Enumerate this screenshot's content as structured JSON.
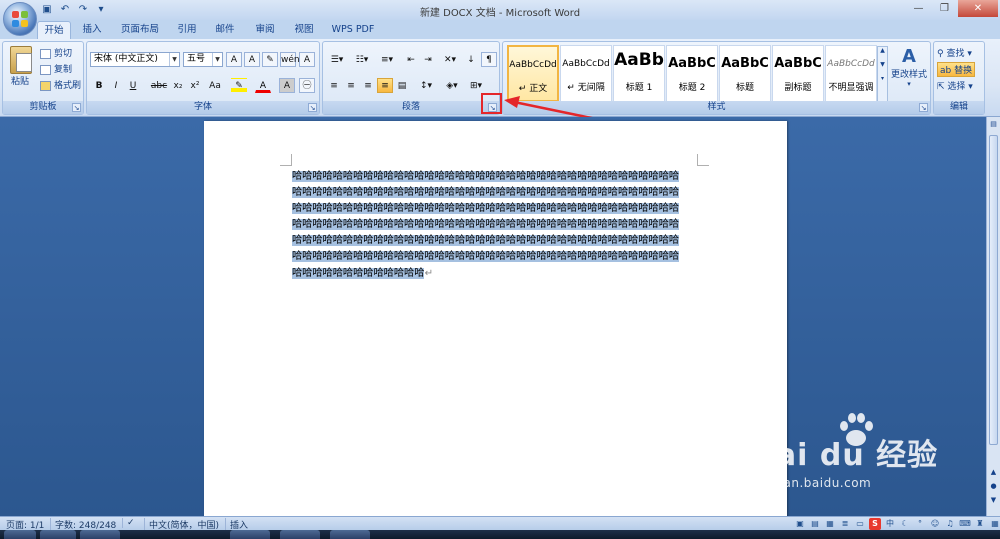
{
  "window": {
    "title": "新建 DOCX 文档 - Microsoft Word",
    "controls": [
      "—",
      "❐",
      "✕"
    ]
  },
  "quick_access": {
    "save_icon": "save-icon",
    "undo_icon": "undo-icon",
    "redo_icon": "redo-icon"
  },
  "tabs": [
    "开始",
    "插入",
    "页面布局",
    "引用",
    "邮件",
    "审阅",
    "视图",
    "WPS PDF"
  ],
  "active_tab": "开始",
  "ribbon": {
    "clipboard": {
      "label": "剪贴板",
      "paste": "粘贴",
      "cut": "剪切",
      "copy": "复制",
      "format_painter": "格式刷"
    },
    "font": {
      "label": "字体",
      "font_name": "宋体 (中文正文)",
      "font_size": "五号",
      "buttons": [
        "B",
        "I",
        "U",
        "abc",
        "x₂",
        "x²",
        "Aa",
        "A",
        "A"
      ]
    },
    "paragraph": {
      "label": "段落"
    },
    "styles": {
      "label": "样式",
      "items": [
        {
          "preview": "AaBbCcDd",
          "name": "↵ 正文"
        },
        {
          "preview": "AaBbCcDd",
          "name": "↵ 无间隔"
        },
        {
          "preview": "AaBb",
          "name": "标题 1"
        },
        {
          "preview": "AaBbC",
          "name": "标题 2"
        },
        {
          "preview": "AaBbC",
          "name": "标题"
        },
        {
          "preview": "AaBbC",
          "name": "副标题"
        },
        {
          "preview": "AaBbCcDd",
          "name": "不明显强调"
        }
      ],
      "change_styles": "更改样式"
    },
    "editing": {
      "label": "编辑",
      "find": "查找 ▾",
      "replace": "替换",
      "select": "选择 ▾"
    }
  },
  "document": {
    "lines": [
      "哈哈哈哈哈哈哈哈哈哈哈哈哈哈哈哈哈哈哈哈哈哈哈哈哈哈哈哈哈哈哈哈哈哈哈哈哈哈",
      "哈哈哈哈哈哈哈哈哈哈哈哈哈哈哈哈哈哈哈哈哈哈哈哈哈哈哈哈哈哈哈哈哈哈哈哈哈哈",
      "哈哈哈哈哈哈哈哈哈哈哈哈哈哈哈哈哈哈哈哈哈哈哈哈哈哈哈哈哈哈哈哈哈哈哈哈哈哈",
      "哈哈哈哈哈哈哈哈哈哈哈哈哈哈哈哈哈哈哈哈哈哈哈哈哈哈哈哈哈哈哈哈哈哈哈哈哈哈",
      "哈哈哈哈哈哈哈哈哈哈哈哈哈哈哈哈哈哈哈哈哈哈哈哈哈哈哈哈哈哈哈哈哈哈哈哈哈哈",
      "哈哈哈哈哈哈哈哈哈哈哈哈哈哈哈哈哈哈哈哈哈哈哈哈哈哈哈哈哈哈哈哈哈哈哈哈哈哈",
      "哈哈哈哈哈哈哈哈哈哈哈哈哈"
    ],
    "return_mark": "↵"
  },
  "status": {
    "page": "页面: 1/1",
    "words": "字数: 248/248",
    "language": "中文(简体，中国)",
    "mode": "插入"
  },
  "tray": {
    "ime": "中"
  },
  "watermark": {
    "brand": "Bai du 经验",
    "url": "jingyan.baidu.com"
  },
  "colors": {
    "highlight_box": "#e4262a",
    "selection": "#a5c0e0",
    "ribbon_bg": "#dbe6f5",
    "doc_bg": "#2c578f"
  }
}
